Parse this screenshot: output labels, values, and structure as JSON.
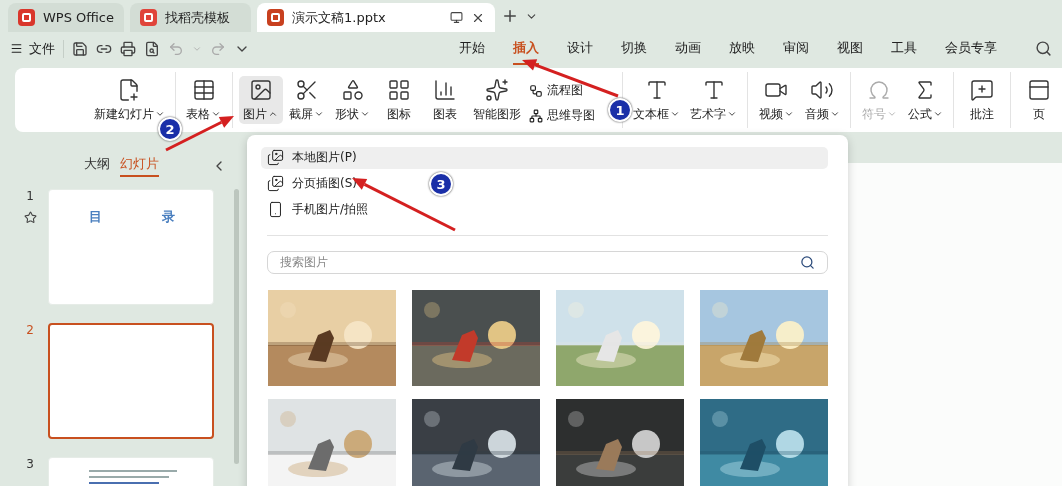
{
  "window_tabs": [
    {
      "kind": "home",
      "label": "WPS Office",
      "selected": false
    },
    {
      "kind": "template",
      "label": "找稻壳模板",
      "selected": false
    },
    {
      "kind": "document",
      "label": "演示文稿1.pptx",
      "selected": true
    }
  ],
  "menu": {
    "file": "文件",
    "ribbon_tabs": [
      {
        "label": "开始",
        "selected": false
      },
      {
        "label": "插入",
        "selected": true
      },
      {
        "label": "设计",
        "selected": false
      },
      {
        "label": "切换",
        "selected": false
      },
      {
        "label": "动画",
        "selected": false
      },
      {
        "label": "放映",
        "selected": false
      },
      {
        "label": "审阅",
        "selected": false
      },
      {
        "label": "视图",
        "selected": false
      },
      {
        "label": "工具",
        "selected": false
      },
      {
        "label": "会员专享",
        "selected": false
      }
    ]
  },
  "ribbon": [
    [
      {
        "kind": "large",
        "label": "新建幻灯片",
        "has_menu": true,
        "expanded": false,
        "disabled": false
      }
    ],
    [
      {
        "kind": "large",
        "label": "表格",
        "has_menu": true,
        "expanded": false,
        "disabled": false
      }
    ],
    [
      {
        "kind": "large",
        "label": "图片",
        "has_menu": true,
        "expanded": true,
        "disabled": false
      },
      {
        "kind": "large",
        "label": "截屏",
        "has_menu": true,
        "expanded": false,
        "disabled": false
      },
      {
        "kind": "large",
        "label": "形状",
        "has_menu": true,
        "expanded": false,
        "disabled": false
      },
      {
        "kind": "large",
        "label": "图标",
        "has_menu": false,
        "expanded": false,
        "disabled": false
      },
      {
        "kind": "large",
        "label": "图表",
        "has_menu": false,
        "expanded": false,
        "disabled": false
      },
      {
        "kind": "large",
        "label": "智能图形",
        "has_menu": false,
        "expanded": false,
        "disabled": false
      },
      {
        "kind": "small",
        "items": [
          "流程图",
          "思维导图"
        ]
      }
    ],
    [
      {
        "kind": "large",
        "label": "文本框",
        "has_menu": true,
        "expanded": false,
        "disabled": false
      },
      {
        "kind": "large",
        "label": "艺术字",
        "has_menu": true,
        "expanded": false,
        "disabled": false
      }
    ],
    [
      {
        "kind": "large",
        "label": "视频",
        "has_menu": true,
        "expanded": false,
        "disabled": false
      },
      {
        "kind": "large",
        "label": "音频",
        "has_menu": true,
        "expanded": false,
        "disabled": false
      }
    ],
    [
      {
        "kind": "large",
        "label": "符号",
        "has_menu": true,
        "expanded": false,
        "disabled": true
      },
      {
        "kind": "large",
        "label": "公式",
        "has_menu": true,
        "expanded": false,
        "disabled": false
      }
    ],
    [
      {
        "kind": "large",
        "label": "批注",
        "has_menu": false,
        "expanded": false,
        "disabled": false
      }
    ],
    [
      {
        "kind": "large",
        "label": "页",
        "has_menu": false,
        "expanded": false,
        "disabled": false
      }
    ]
  ],
  "side_panel": {
    "tabs": [
      {
        "label": "大纲",
        "selected": false
      },
      {
        "label": "幻灯片",
        "selected": true
      }
    ],
    "slides": [
      {
        "number": "1",
        "selected": false,
        "starred": true,
        "title": [
          "目",
          "录"
        ]
      },
      {
        "number": "2",
        "selected": true,
        "starred": false
      },
      {
        "number": "3",
        "selected": false,
        "starred": false
      }
    ]
  },
  "picture_menu": {
    "items": [
      {
        "label": "本地图片(P)",
        "selected": true
      },
      {
        "label": "分页插图(S)",
        "selected": false
      },
      {
        "label": "手机图片/拍照",
        "selected": false
      }
    ],
    "search": {
      "placeholder": "搜索图片"
    },
    "pictures": [
      {
        "kind": "horse"
      },
      {
        "kind": "target"
      },
      {
        "kind": "turbine"
      },
      {
        "kind": "sunset"
      },
      {
        "kind": "snow"
      },
      {
        "kind": "person"
      },
      {
        "kind": "chalkboard"
      },
      {
        "kind": "chart"
      }
    ]
  },
  "annotations": [
    {
      "number": "1"
    },
    {
      "number": "2"
    },
    {
      "number": "3"
    }
  ]
}
